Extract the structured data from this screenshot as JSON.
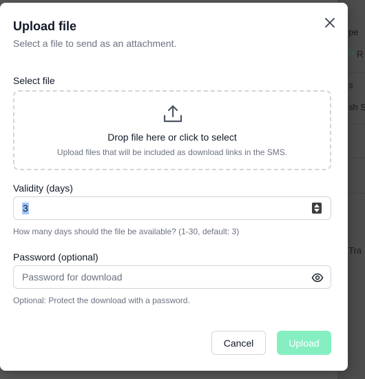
{
  "background": {
    "col_texts": [
      "pe",
      "R",
      "s",
      "sh S",
      "Tra"
    ]
  },
  "dialog": {
    "title": "Upload file",
    "subtitle": "Select a file to send as an attachment.",
    "close_icon": "close-icon"
  },
  "file": {
    "label": "Select file",
    "drop_title": "Drop file here or click to select",
    "drop_sub": "Upload files that will be included as download links in the SMS.",
    "icon": "upload-icon"
  },
  "validity": {
    "label": "Validity (days)",
    "value": "3",
    "help": "How many days should the file be available? (1-30, default: 3)"
  },
  "password": {
    "label": "Password (optional)",
    "placeholder": "Password for download",
    "help": "Optional: Protect the download with a password.",
    "icon": "eye-icon"
  },
  "actions": {
    "cancel": "Cancel",
    "upload": "Upload"
  },
  "colors": {
    "primary_disabled": "#86efc1",
    "overlay": "#5a5a5a"
  }
}
